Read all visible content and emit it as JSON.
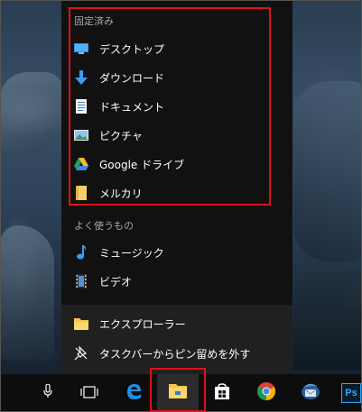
{
  "jumplist": {
    "pinned_title": "固定済み",
    "pinned": [
      {
        "label": "デスクトップ",
        "icon": "desktop-icon"
      },
      {
        "label": "ダウンロード",
        "icon": "download-icon"
      },
      {
        "label": "ドキュメント",
        "icon": "document-icon"
      },
      {
        "label": "ピクチャ",
        "icon": "picture-icon"
      },
      {
        "label": "Google ドライブ",
        "icon": "google-drive-icon"
      },
      {
        "label": "メルカリ",
        "icon": "folder-icon"
      }
    ],
    "frequent_title": "よく使うもの",
    "frequent": [
      {
        "label": "ミュージック",
        "icon": "music-icon"
      },
      {
        "label": "ビデオ",
        "icon": "video-icon"
      }
    ],
    "app_label": "エクスプローラー",
    "unpin_label": "タスクバーからピン留めを外す"
  },
  "taskbar": {
    "items": [
      "microphone-icon",
      "task-view-icon",
      "edge-icon",
      "file-explorer-icon",
      "store-icon",
      "chrome-icon",
      "thunderbird-icon",
      "photoshop-icon"
    ],
    "photoshop_text": "Ps"
  },
  "colors": {
    "highlight": "#e0101b",
    "panel": "#111111",
    "accent": "#76b9ed"
  }
}
